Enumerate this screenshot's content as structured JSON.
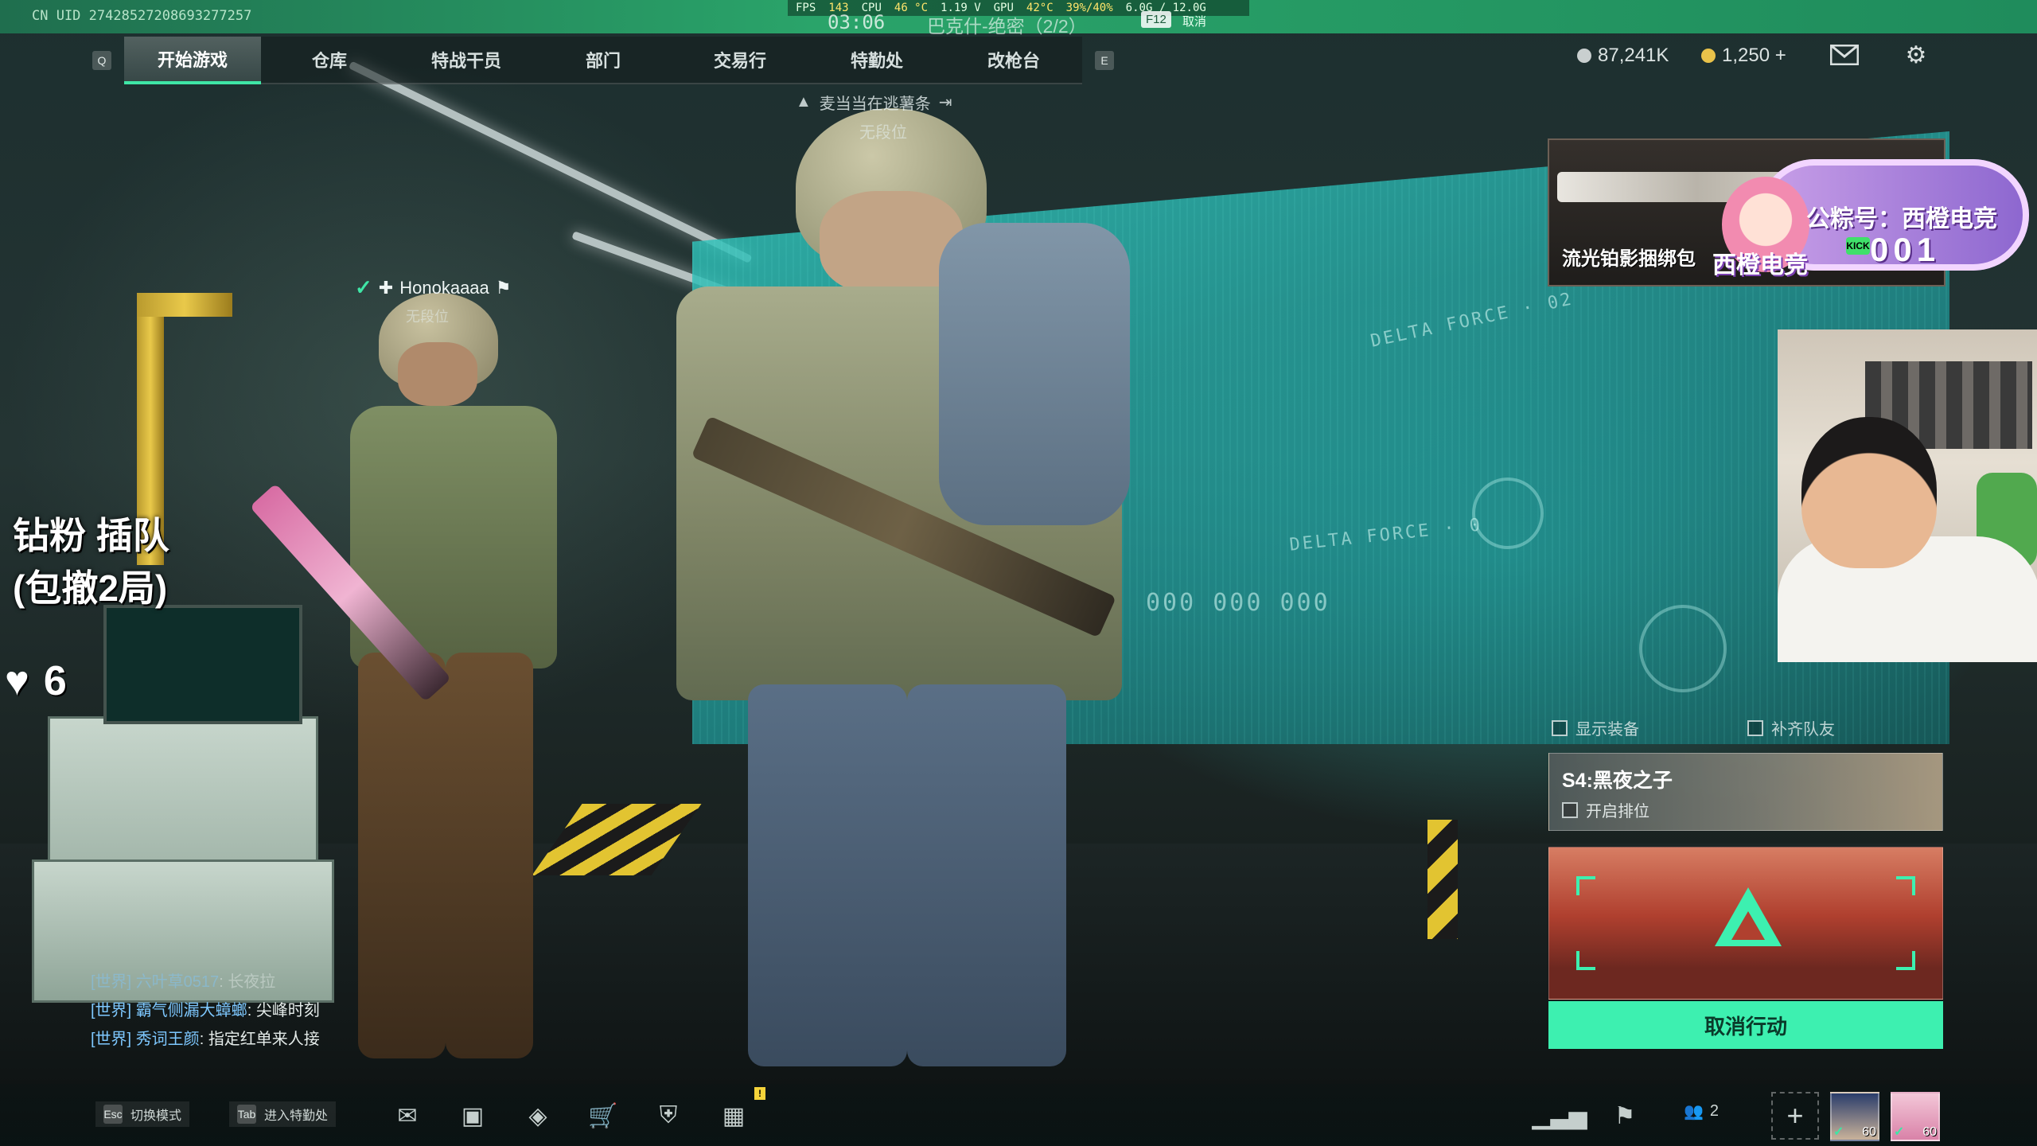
{
  "topbar": {
    "uid": "CN UID 27428527208693277257",
    "perf": {
      "fps_label": "FPS",
      "fps": "143",
      "cpu_label": "CPU",
      "cpu_temp": "46 °C",
      "voltage": "1.19 V",
      "gpu_label": "GPU",
      "gpu_temp": "42°C",
      "gpu_load": "39%/40%",
      "mem": "6.0G / 12.0G"
    },
    "clock": "03:06",
    "map": "巴克什-绝密（2/2）",
    "f12_key": "F12",
    "f12_action": "取消"
  },
  "nav": {
    "prev_key": "Q",
    "next_key": "E",
    "tabs": [
      {
        "label": "开始游戏",
        "active": true
      },
      {
        "label": "仓库",
        "active": false
      },
      {
        "label": "特战干员",
        "active": false
      },
      {
        "label": "部门",
        "active": false
      },
      {
        "label": "交易行",
        "active": false
      },
      {
        "label": "特勤处",
        "active": false
      },
      {
        "label": "改枪台",
        "active": false
      }
    ]
  },
  "currency": {
    "silver": "87,241K",
    "gold": "1,250 +",
    "silver_color": "#c9cfcf",
    "gold_color": "#e9c24a"
  },
  "icons": {
    "mail": "mail-icon",
    "settings": "gear-icon"
  },
  "broadcast": {
    "text": "麦当当在逃薯条",
    "rank": "无段位"
  },
  "teammate": {
    "name": "Honokaaaa",
    "rank": "无段位"
  },
  "stream_overlay": {
    "line1": "钻粉 插队",
    "line2": "(包撤2局)",
    "hearts": "6"
  },
  "chat": [
    {
      "channel": "[世界]",
      "user": "六叶草0517",
      "msg": "长夜拉",
      "faded": true
    },
    {
      "channel": "[世界]",
      "user": "霸气侧漏大蟑螂",
      "msg": "尖峰时刻",
      "faded": false
    },
    {
      "channel": "[世界]",
      "user": "秀词王颜",
      "msg": "指定红单来人接",
      "faded": false
    }
  ],
  "sponsor": {
    "item_name": "流光铂影捆绑包",
    "brand": "西橙电竞",
    "account_label": "公粽号：西橙电竞",
    "number": "001",
    "kick_tag": "KICK"
  },
  "loadout": {
    "show_gear": "显示装备",
    "fill_squad": "补齐队友"
  },
  "season": {
    "title": "S4:黑夜之子",
    "ranked_label": "开启排位"
  },
  "action": {
    "cancel_label": "取消行动",
    "accent_color": "#3df0b0"
  },
  "bottombar": {
    "esc_key": "Esc",
    "esc_label": "切换模式",
    "tab_key": "Tab",
    "tab_label": "进入特勤处",
    "notice_badge": "!",
    "friends_count": "2",
    "add_label": "+",
    "slots": [
      {
        "level": "60"
      },
      {
        "level": "60"
      }
    ]
  }
}
